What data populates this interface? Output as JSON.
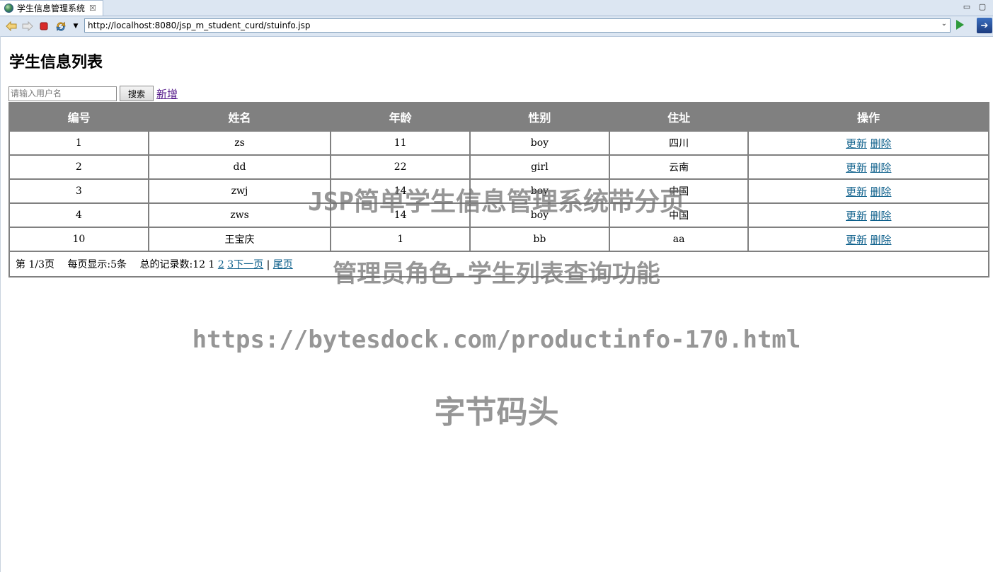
{
  "browser": {
    "tab_title": "学生信息管理系统",
    "tab_close": "☒",
    "window_minimize": "▭",
    "window_maximize": "▢",
    "url": "http://localhost:8080/jsp_m_student_curd/stuinfo.jsp",
    "icons": {
      "back": "back-arrow-icon",
      "forward": "forward-arrow-icon",
      "stop": "stop-icon",
      "refresh": "refresh-icon",
      "menu": "dropdown-icon",
      "go": "go-icon",
      "external": "external-browser-icon"
    }
  },
  "page": {
    "title": "学生信息列表",
    "search": {
      "placeholder": "请输入用户名",
      "button_label": "搜索"
    },
    "add_link": "新增",
    "table": {
      "headers": [
        "编号",
        "姓名",
        "年龄",
        "性别",
        "住址",
        "操作"
      ],
      "rows": [
        {
          "id": "1",
          "name": "zs",
          "age": "11",
          "gender": "boy",
          "address": "四川"
        },
        {
          "id": "2",
          "name": "dd",
          "age": "22",
          "gender": "girl",
          "address": "云南"
        },
        {
          "id": "3",
          "name": "zwj",
          "age": "14",
          "gender": "boy",
          "address": "中国"
        },
        {
          "id": "4",
          "name": "zws",
          "age": "14",
          "gender": "boy",
          "address": "中国"
        },
        {
          "id": "10",
          "name": "王宝庆",
          "age": "1",
          "gender": "bb",
          "address": "aa"
        }
      ],
      "update_label": "更新",
      "delete_label": "删除"
    },
    "pager": {
      "page_info": "第 1/3页",
      "per_page": "每页显示:5条",
      "total": "总的记录数:12",
      "current_page": "1",
      "page2": "2",
      "page3": "3",
      "next": "下一页",
      "separator": "|",
      "last": "尾页"
    }
  },
  "watermark": {
    "line1": "JSP简单学生信息管理系统带分页",
    "line2": "管理员角色-学生列表查询功能",
    "line3": "https://bytesdock.com/productinfo-170.html",
    "line4": "字节码头"
  },
  "colors": {
    "header_bg": "#808080",
    "link": "#0b5e8a",
    "visited_link": "#551a8b",
    "chrome_bg": "#dce6f2"
  }
}
